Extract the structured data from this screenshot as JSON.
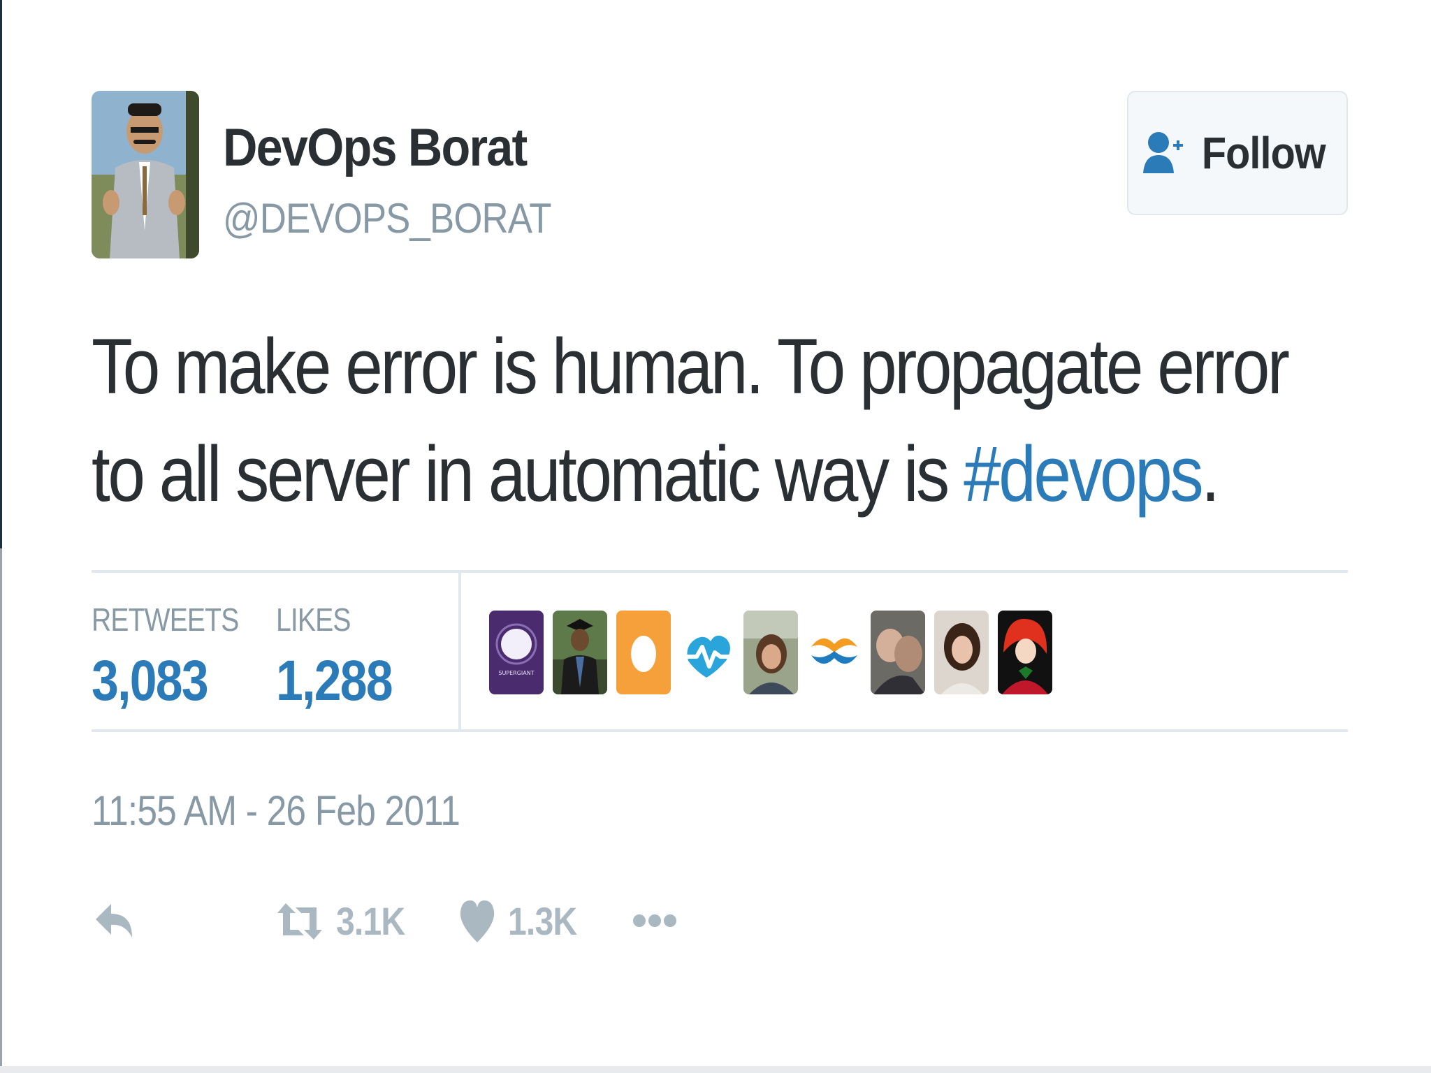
{
  "author": {
    "name": "DevOps Borat",
    "handle": "@DEVOPS_BORAT"
  },
  "follow_button": {
    "label": "Follow",
    "icon": "add-user-icon"
  },
  "tweet": {
    "text_prefix": "To make error is human. To propagate error to all server in automatic way is ",
    "hashtag": "#devops",
    "text_suffix": "."
  },
  "stats": {
    "retweets_label": "RETWEETS",
    "retweets_value": "3,083",
    "likes_label": "LIKES",
    "likes_value": "1,288"
  },
  "likers": {
    "count_shown": 9,
    "superagent_text": "SUPERGIANT"
  },
  "timestamp": "11:55 AM - 26 Feb 2011",
  "actions": {
    "reply_icon": "reply-icon",
    "retweet_icon": "retweet-icon",
    "retweet_count": "3.1K",
    "like_icon": "heart-icon",
    "like_count": "1.3K",
    "more_icon": "more-dots-icon"
  },
  "colors": {
    "link": "#2b7bb9",
    "muted": "#8899a6",
    "text": "#292f33",
    "action_icon": "#aab8c2",
    "border": "#e1e8ed"
  }
}
